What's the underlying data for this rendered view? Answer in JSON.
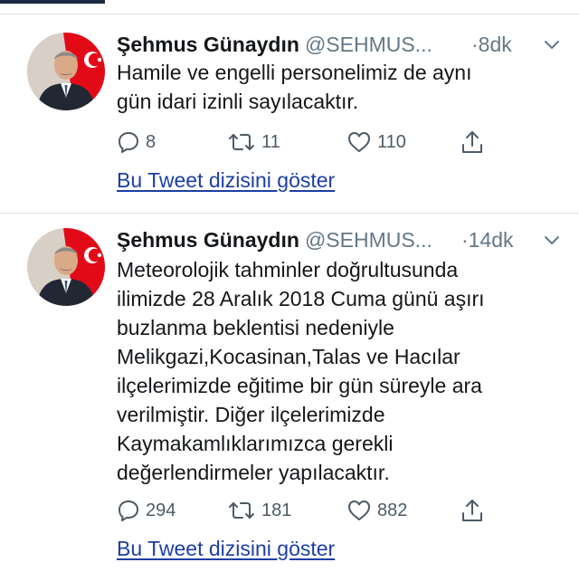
{
  "tweets": [
    {
      "author_name": "Şehmus Günaydın",
      "author_handle": "@SEHMUS...",
      "time": "·8dk",
      "lines": [
        "Hamile ve engelli personelimiz de aynı",
        "gün idari izinli sayılacaktır."
      ],
      "replies": "8",
      "retweets": "11",
      "likes": "110",
      "show_thread_label": "Bu Tweet dizisini göster"
    },
    {
      "author_name": "Şehmus Günaydın",
      "author_handle": "@SEHMUS...",
      "time": "·14dk",
      "lines": [
        "Meteorolojik tahminler doğrultusunda",
        "ilimizde 28 Aralık 2018 Cuma günü aşırı",
        "buzlanma beklentisi nedeniyle",
        "Melikgazi,Kocasinan,Talas ve Hacılar",
        "ilçelerimizde eğitime bir gün süreyle ara",
        "verilmiştir. Diğer ilçelerimizde",
        "Kaymakamlıklarımızca gerekli",
        "değerlendirmeler yapılacaktır."
      ],
      "replies": "294",
      "retweets": "181",
      "likes": "882",
      "show_thread_label": "Bu Tweet dizisini göster"
    }
  ],
  "colors": {
    "text": "#14171a",
    "secondary": "#657786",
    "link": "#1d3fa3",
    "divider": "#dfe3e7",
    "flag_red": "#e30a17"
  }
}
